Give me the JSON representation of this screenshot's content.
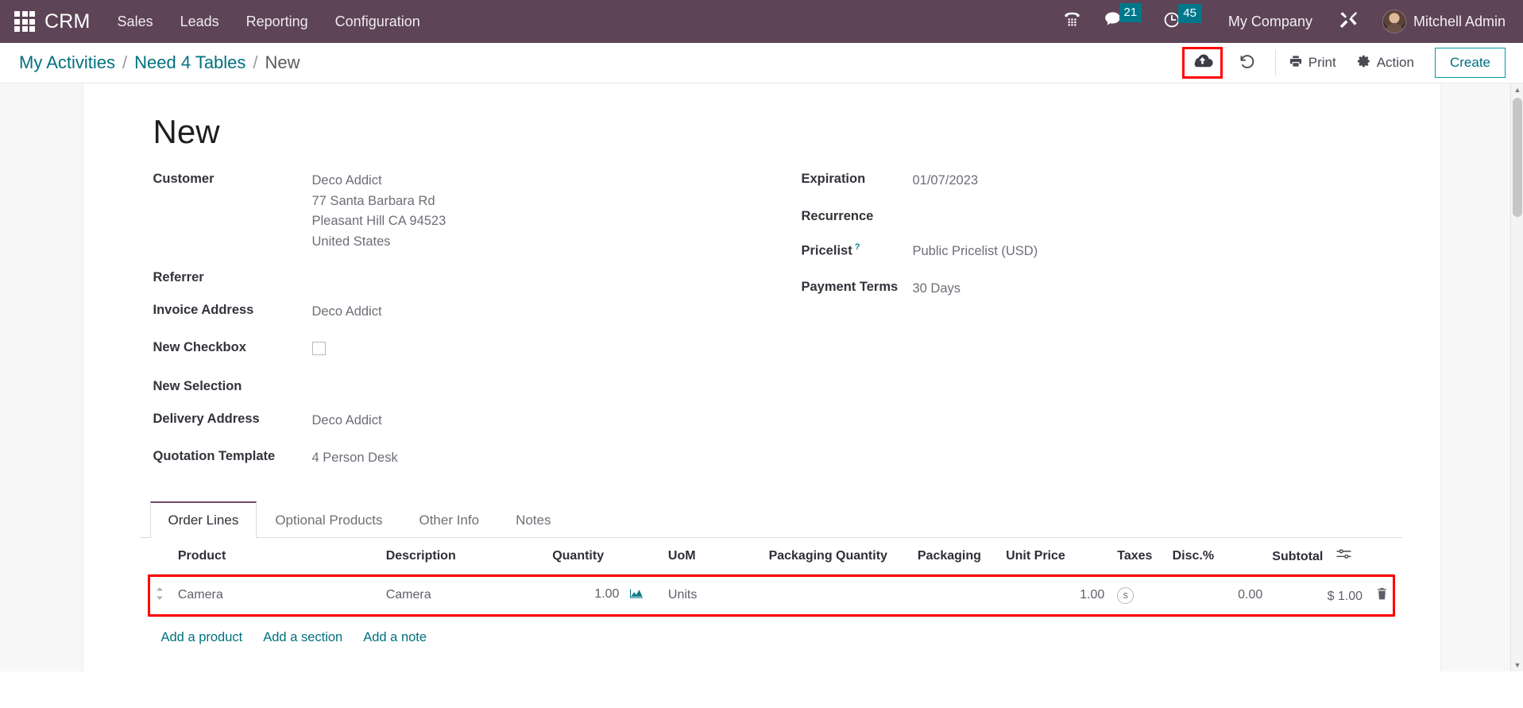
{
  "navbar": {
    "apps_icon": "apps-grid-icon",
    "brand": "CRM",
    "menus": [
      "Sales",
      "Leads",
      "Reporting",
      "Configuration"
    ],
    "phone_icon": "dialpad-phone-icon",
    "messages_icon": "chat-bubble-icon",
    "messages_count": "21",
    "activities_icon": "clock-icon",
    "activities_count": "45",
    "company": "My Company",
    "tools_icon": "wrench-screwdriver-icon",
    "user": "Mitchell Admin",
    "avatar_icon": "user-avatar"
  },
  "control_panel": {
    "breadcrumb": [
      "My Activities",
      "Need 4 Tables",
      "New"
    ],
    "save_icon": "cloud-upload-icon",
    "discard_icon": "undo-arrow-icon",
    "print_icon": "printer-icon",
    "print_label": "Print",
    "action_icon": "gear-icon",
    "action_label": "Action",
    "create_label": "Create"
  },
  "record": {
    "title": "New"
  },
  "form": {
    "left": [
      {
        "label": "Customer",
        "value": "Deco Addict",
        "extra_lines": [
          "77 Santa Barbara Rd",
          "Pleasant Hill CA 94523",
          "United States"
        ]
      },
      {
        "label": "Referrer",
        "value": ""
      },
      {
        "label": "Invoice Address",
        "value": "Deco Addict"
      },
      {
        "label": "New Checkbox",
        "value": "",
        "type": "checkbox",
        "checked": false
      },
      {
        "label": "New Selection",
        "value": ""
      },
      {
        "label": "Delivery Address",
        "value": "Deco Addict"
      },
      {
        "label": "Quotation Template",
        "value": "4 Person Desk"
      }
    ],
    "right": [
      {
        "label": "Expiration",
        "value": "01/07/2023"
      },
      {
        "label": "Recurrence",
        "value": ""
      },
      {
        "label": "Pricelist",
        "value": "Public Pricelist (USD)",
        "tooltip": "?"
      },
      {
        "label": "Payment Terms",
        "value": "30 Days"
      }
    ]
  },
  "notebook": {
    "tabs": [
      {
        "label": "Order Lines",
        "active": true
      },
      {
        "label": "Optional Products",
        "active": false
      },
      {
        "label": "Other Info",
        "active": false
      },
      {
        "label": "Notes",
        "active": false
      }
    ]
  },
  "order_lines": {
    "columns": [
      "Product",
      "Description",
      "Quantity",
      "UoM",
      "Packaging Quantity",
      "Packaging",
      "Unit Price",
      "Taxes",
      "Disc.%",
      "Subtotal"
    ],
    "optional_columns_icon": "column-options-icon",
    "rows": [
      {
        "handle_icon": "drag-handle-icon",
        "product": "Camera",
        "description": "Camera",
        "quantity": "1.00",
        "quantity_icon": "forecast-chart-icon",
        "uom": "Units",
        "packaging_quantity": "",
        "packaging": "",
        "unit_price": "1.00",
        "taxes": "s",
        "discount": "0.00",
        "subtotal": "$ 1.00",
        "delete_icon": "trash-icon",
        "highlighted": true
      }
    ],
    "add_links": [
      "Add a product",
      "Add a section",
      "Add a note"
    ]
  },
  "colors": {
    "navbar_bg": "#5d4456",
    "accent_teal": "#00707f",
    "badge_teal": "#00788a",
    "highlight_red": "#ff0000",
    "tab_active_border": "#714b67"
  }
}
